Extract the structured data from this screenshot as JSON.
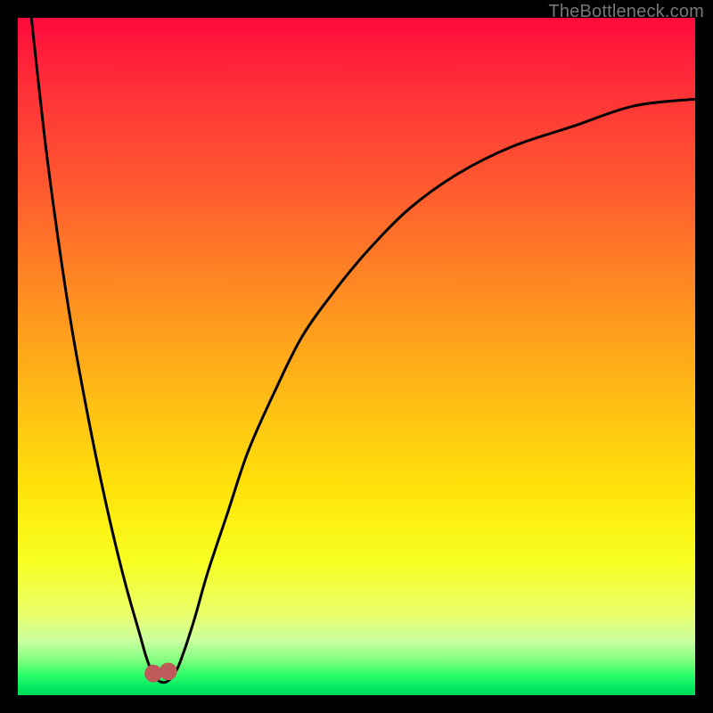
{
  "watermark": "TheBottleneck.com",
  "chart_data": {
    "type": "line",
    "title": "",
    "xlabel": "",
    "ylabel": "",
    "xlim": [
      0,
      100
    ],
    "ylim": [
      0,
      100
    ],
    "grid": false,
    "series": [
      {
        "name": "bottleneck-curve",
        "x": [
          2,
          4,
          6,
          8,
          10,
          12,
          14,
          16,
          18,
          19,
          20,
          21,
          22,
          23,
          24,
          26,
          28,
          31,
          34,
          38,
          42,
          47,
          52,
          58,
          65,
          73,
          82,
          91,
          100
        ],
        "y": [
          100,
          82,
          67,
          54,
          43,
          33,
          24,
          16,
          9,
          5.5,
          3,
          2,
          2,
          3,
          5,
          11,
          18,
          27,
          36,
          45,
          53,
          60,
          66,
          72,
          77,
          81,
          84,
          87,
          88
        ]
      }
    ],
    "markers": [
      {
        "name": "min-marker-left",
        "x": 20,
        "y": 3.2,
        "r": 1.3,
        "color": "#c05a5a"
      },
      {
        "name": "min-marker-right",
        "x": 22.2,
        "y": 3.5,
        "r": 1.3,
        "color": "#c05a5a"
      }
    ],
    "gradient_stops": [
      {
        "pos": 0,
        "color": "#ff0a3c"
      },
      {
        "pos": 25,
        "color": "#ff5a2f"
      },
      {
        "pos": 55,
        "color": "#ffb915"
      },
      {
        "pos": 80,
        "color": "#f8ff20"
      },
      {
        "pos": 95,
        "color": "#7cff7c"
      },
      {
        "pos": 100,
        "color": "#00d858"
      }
    ]
  }
}
